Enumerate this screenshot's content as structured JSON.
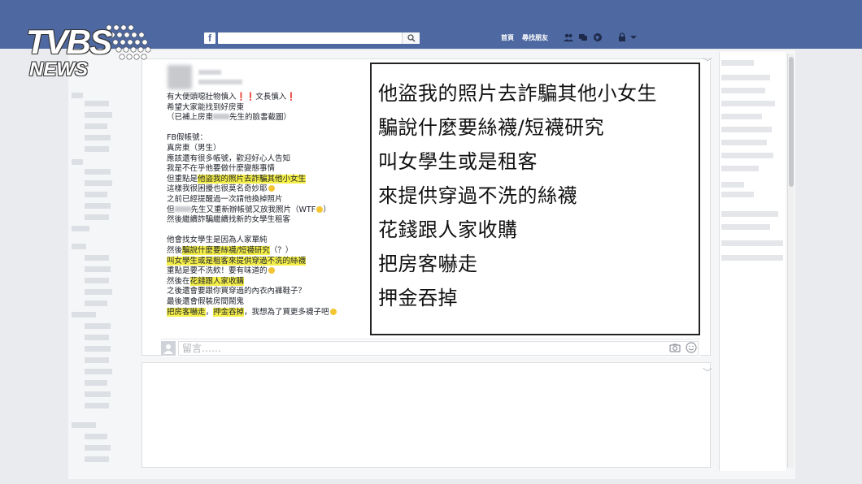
{
  "topbar": {
    "fb_logo": "f",
    "nav_home": "首頁",
    "nav_find_friends": "尋找朋友"
  },
  "watermark": {
    "brand": "TVBS",
    "sub": "NEWS"
  },
  "post": {
    "lines": [
      {
        "id": "l1",
        "parts": [
          {
            "t": "有大便頭噁壯物慎入"
          },
          {
            "t": "❗❗",
            "cls": "red-mark"
          },
          {
            "t": "文長慎入"
          },
          {
            "t": "❗",
            "cls": "red-mark"
          }
        ]
      },
      {
        "id": "l2",
        "parts": [
          {
            "t": "希望大家能找到好房東"
          }
        ]
      },
      {
        "id": "l3",
        "parts": [
          {
            "t": "（已補上房東"
          },
          {
            "blur": true
          },
          {
            "t": "先生的臉書截圖）"
          }
        ]
      },
      {
        "id": "l4",
        "parts": [
          {
            "t": ""
          }
        ]
      },
      {
        "id": "l5",
        "parts": [
          {
            "t": "FB假帳號："
          }
        ]
      },
      {
        "id": "l6",
        "parts": [
          {
            "t": "真房東（男生）"
          }
        ]
      },
      {
        "id": "l7",
        "parts": [
          {
            "t": "應該還有很多帳號，歡迎好心人告知"
          }
        ]
      },
      {
        "id": "l8",
        "parts": [
          {
            "t": "我是不在乎他要做什麼變態事情"
          }
        ]
      },
      {
        "id": "l9",
        "parts": [
          {
            "t": "但重點是"
          },
          {
            "t": "他盜我的照片去詐騙其他小女生",
            "cls": "hl"
          }
        ]
      },
      {
        "id": "l10",
        "parts": [
          {
            "t": "這樣我很困擾也很莫名奇妙耶"
          },
          {
            "emoji": true
          }
        ]
      },
      {
        "id": "l11",
        "parts": [
          {
            "t": "之前已經提醒過一次請他換掉照片"
          }
        ]
      },
      {
        "id": "l12",
        "parts": [
          {
            "t": "但"
          },
          {
            "blur": true
          },
          {
            "t": "先生又重新辦帳號又放我照片（WTF"
          },
          {
            "emoji": true
          },
          {
            "t": "）"
          }
        ]
      },
      {
        "id": "l13",
        "parts": [
          {
            "t": "然後繼續詐騙繼續找新的女學生租客"
          }
        ]
      },
      {
        "id": "l14",
        "parts": [
          {
            "t": ""
          }
        ]
      },
      {
        "id": "l15",
        "parts": [
          {
            "t": "他會找女學生是因為人家單純"
          }
        ]
      },
      {
        "id": "l16",
        "parts": [
          {
            "t": "然後"
          },
          {
            "t": "騙說什麼要絲襪/短襪研究",
            "cls": "hl"
          },
          {
            "t": "（？）"
          }
        ]
      },
      {
        "id": "l17",
        "parts": [
          {
            "t": "叫女學生或是租客來提供穿過不洗的絲襪",
            "cls": "hl"
          }
        ]
      },
      {
        "id": "l18",
        "parts": [
          {
            "t": "重點是要不洗欸！要有味道的"
          },
          {
            "emoji": true
          }
        ]
      },
      {
        "id": "l19",
        "parts": [
          {
            "t": "然後在"
          },
          {
            "t": "花錢跟人家收購",
            "cls": "hl"
          }
        ]
      },
      {
        "id": "l20",
        "parts": [
          {
            "t": "之後還會要跟你買穿過的內衣內褲鞋子？"
          }
        ]
      },
      {
        "id": "l21",
        "parts": [
          {
            "t": "最後還會假裝房間鬧鬼"
          }
        ]
      },
      {
        "id": "l22",
        "parts": [
          {
            "t": "把房客嚇走",
            "cls": "hl"
          },
          {
            "t": "，"
          },
          {
            "t": "押金吞掉",
            "cls": "hl"
          },
          {
            "t": "，我想為了買更多襪子吧"
          },
          {
            "emoji": true
          }
        ]
      }
    ]
  },
  "callout": {
    "lines": [
      "他盜我的照片去詐騙其他小女生",
      "騙說什麼要絲襪/短襪研究",
      "叫女學生或是租客",
      "來提供穿過不洗的絲襪",
      "花錢跟人家收購",
      "把房客嚇走",
      "押金吞掉"
    ]
  },
  "comment": {
    "placeholder": "留言……"
  },
  "colors": {
    "topbar": "#4e69a2",
    "highlight": "#f5ef4a",
    "red_mark": "#e0211f"
  }
}
